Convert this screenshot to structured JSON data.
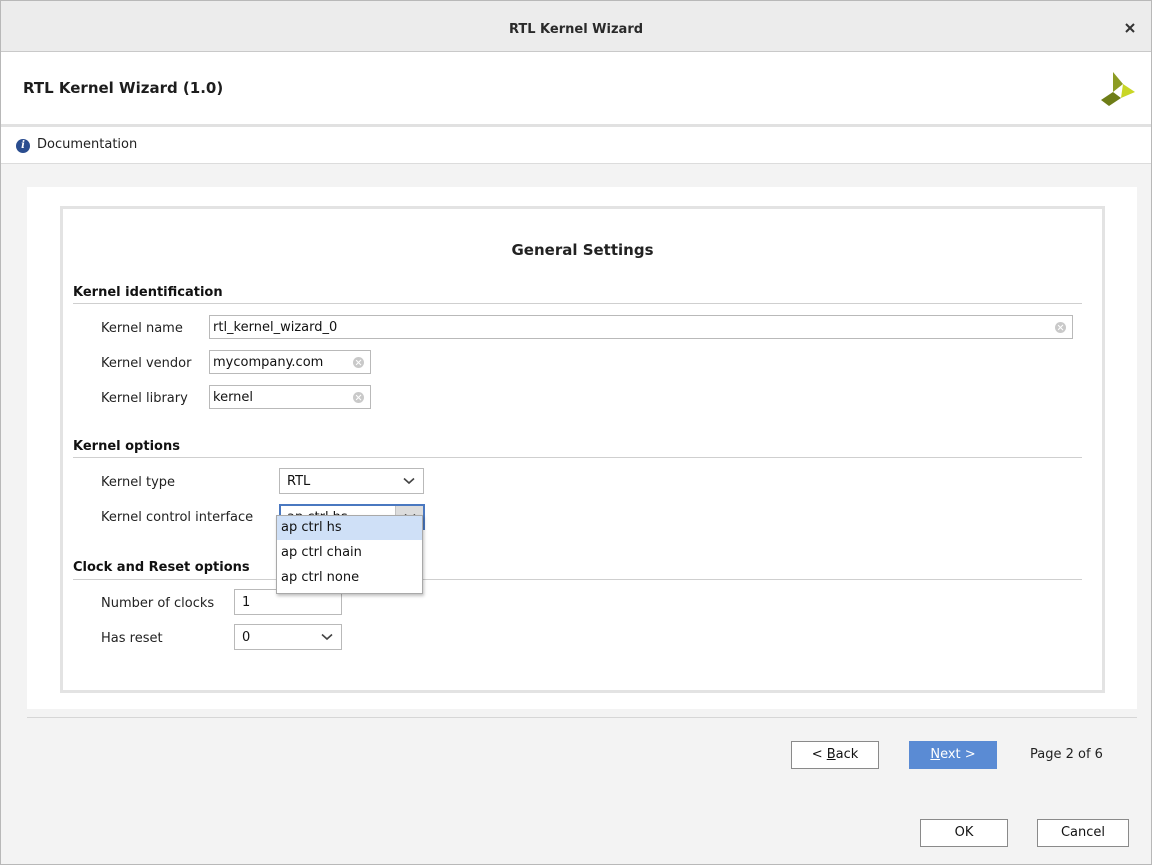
{
  "window": {
    "title": "RTL Kernel Wizard"
  },
  "header": {
    "title": "RTL Kernel Wizard (1.0)"
  },
  "docbar": {
    "link": "Documentation"
  },
  "settings": {
    "title": "General Settings",
    "kernel_identification": {
      "heading": "Kernel identification",
      "name_label": "Kernel name",
      "name_value": "rtl_kernel_wizard_0",
      "vendor_label": "Kernel vendor",
      "vendor_value": "mycompany.com",
      "library_label": "Kernel library",
      "library_value": "kernel"
    },
    "kernel_options": {
      "heading": "Kernel options",
      "type_label": "Kernel type",
      "type_value": "RTL",
      "control_label": "Kernel control interface",
      "control_value": "ap ctrl hs",
      "control_options": [
        "ap ctrl hs",
        "ap ctrl chain",
        "ap ctrl none"
      ]
    },
    "clock_reset": {
      "heading": "Clock and Reset options",
      "clocks_label": "Number of clocks",
      "clocks_value": "1",
      "reset_label": "Has reset",
      "reset_value": "0"
    }
  },
  "nav": {
    "back_mnemonic": "B",
    "back_rest": "ack",
    "back_prefix": "< ",
    "next_mnemonic": "N",
    "next_rest": "ext >",
    "page": "Page 2 of 6"
  },
  "footer": {
    "ok_label": "OK",
    "cancel_label": "Cancel"
  },
  "colors": {
    "accent": "#5a8bd4",
    "selection": "#cfe0f7",
    "logo_dark": "#7a8a1c",
    "logo_light": "#c9d626"
  }
}
